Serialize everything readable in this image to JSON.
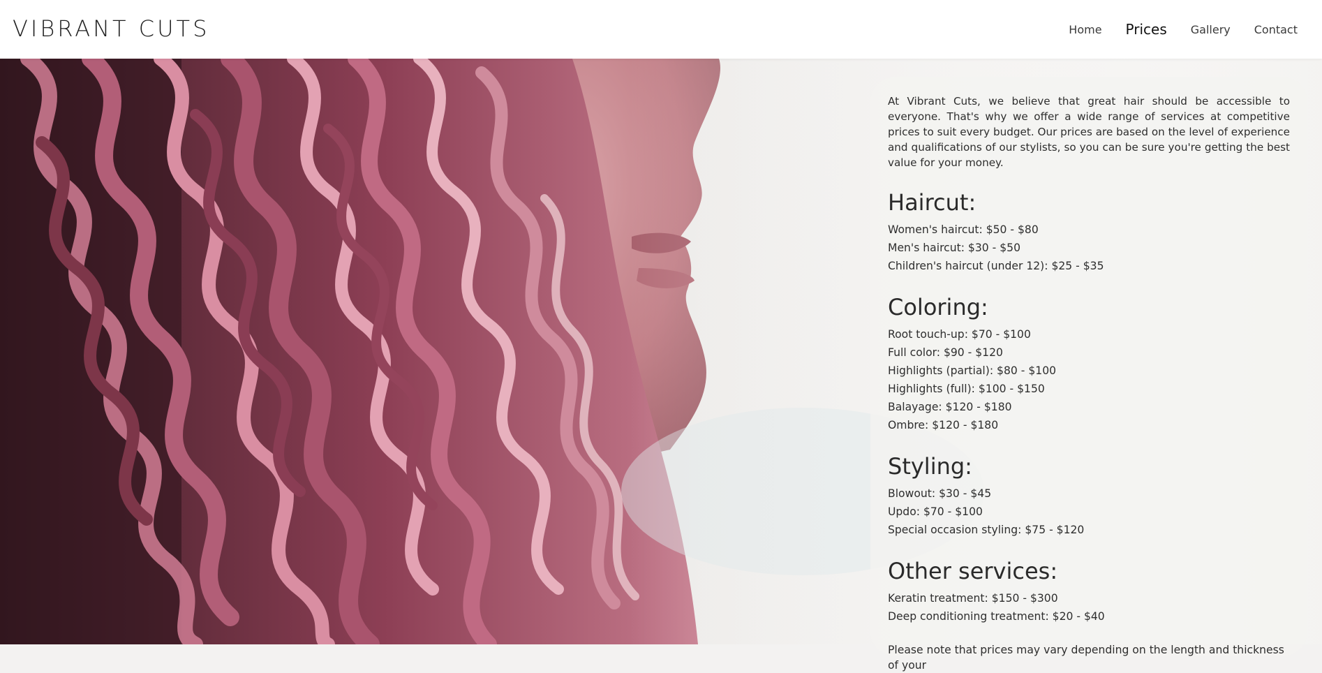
{
  "header": {
    "logo": "VIBRANT CUTS",
    "nav": [
      {
        "label": "Home",
        "active": false
      },
      {
        "label": "Prices",
        "active": true
      },
      {
        "label": "Gallery",
        "active": false
      },
      {
        "label": "Contact",
        "active": false
      }
    ]
  },
  "hero": {
    "image": "woman-with-curly-pink-hair-profile"
  },
  "prices": {
    "intro": "At Vibrant Cuts, we believe that great hair should be accessible to everyone. That's why we offer a wide range of services at competitive prices to suit every budget. Our prices are based on the level of experience and qualifications of our stylists, so you can be sure you're getting the best value for your money.",
    "sections": [
      {
        "title": "Haircut:",
        "items": [
          "Women's haircut: $50 - $80",
          "Men's haircut: $30 - $50",
          "Children's haircut (under 12): $25 - $35"
        ]
      },
      {
        "title": "Coloring:",
        "items": [
          "Root touch-up: $70 - $100",
          "Full color: $90 - $120",
          "Highlights (partial): $80 - $100",
          "Highlights (full): $100 - $150",
          "Balayage: $120 - $180",
          "Ombre: $120 - $180"
        ]
      },
      {
        "title": "Styling:",
        "items": [
          "Blowout: $30 - $45",
          "Updo: $70 - $100",
          "Special occasion styling: $75 - $120"
        ]
      },
      {
        "title": "Other services:",
        "items": [
          "Keratin treatment: $150 - $300",
          "Deep conditioning treatment: $20 - $40"
        ]
      }
    ],
    "note": "Please note that prices may vary depending on the length and thickness of your"
  },
  "colors": {
    "hair": "#b0566f",
    "hair_highlight": "#e6a3b2",
    "skin": "#c98a91",
    "background_light": "#f3f2f1"
  }
}
